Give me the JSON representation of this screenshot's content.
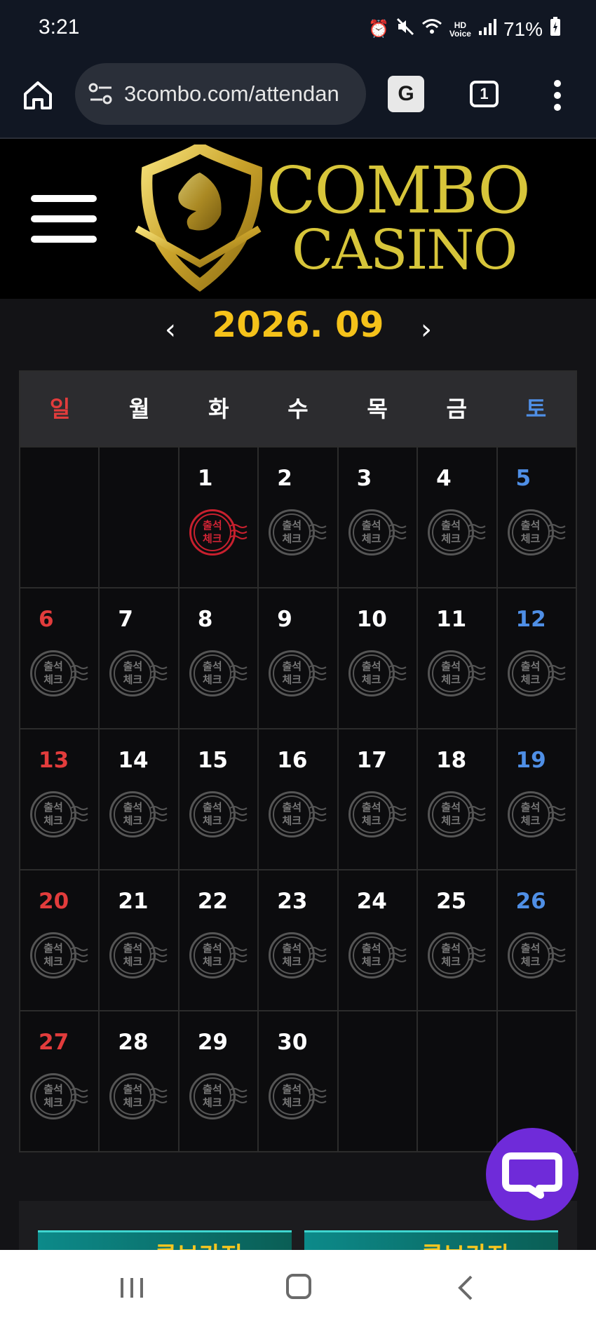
{
  "status_bar": {
    "time": "3:21",
    "battery": "71%",
    "icons": [
      "alarm-icon",
      "mute-icon",
      "wifi-icon",
      "hd-voice-icon",
      "signal-icon",
      "battery-icon"
    ]
  },
  "browser": {
    "url": "3combo.com/attendan",
    "tab_count": "1",
    "translate_label": "G"
  },
  "header": {
    "logo_line1": "COMBO",
    "logo_line2": "CASINO",
    "brand_color": "#d7c53a"
  },
  "calendar": {
    "month_label": "2026. 09",
    "prev_label": "‹",
    "next_label": "›",
    "weekdays": [
      "일",
      "월",
      "화",
      "수",
      "목",
      "금",
      "토"
    ],
    "stamp_line1": "출석",
    "stamp_line2": "체크",
    "checked_days": [
      1
    ],
    "weeks": [
      [
        "",
        "",
        "1",
        "2",
        "3",
        "4",
        "5"
      ],
      [
        "6",
        "7",
        "8",
        "9",
        "10",
        "11",
        "12"
      ],
      [
        "13",
        "14",
        "15",
        "16",
        "17",
        "18",
        "19"
      ],
      [
        "20",
        "21",
        "22",
        "23",
        "24",
        "25",
        "26"
      ],
      [
        "27",
        "28",
        "29",
        "30",
        "",
        "",
        ""
      ]
    ]
  },
  "banners": {
    "left_text": "콤보카지",
    "right_text": "콤보카지"
  },
  "colors": {
    "month": "#f5c21a",
    "sunday": "#e23c3c",
    "saturday": "#4f8fe6",
    "chat_button": "#6f2bd9"
  }
}
